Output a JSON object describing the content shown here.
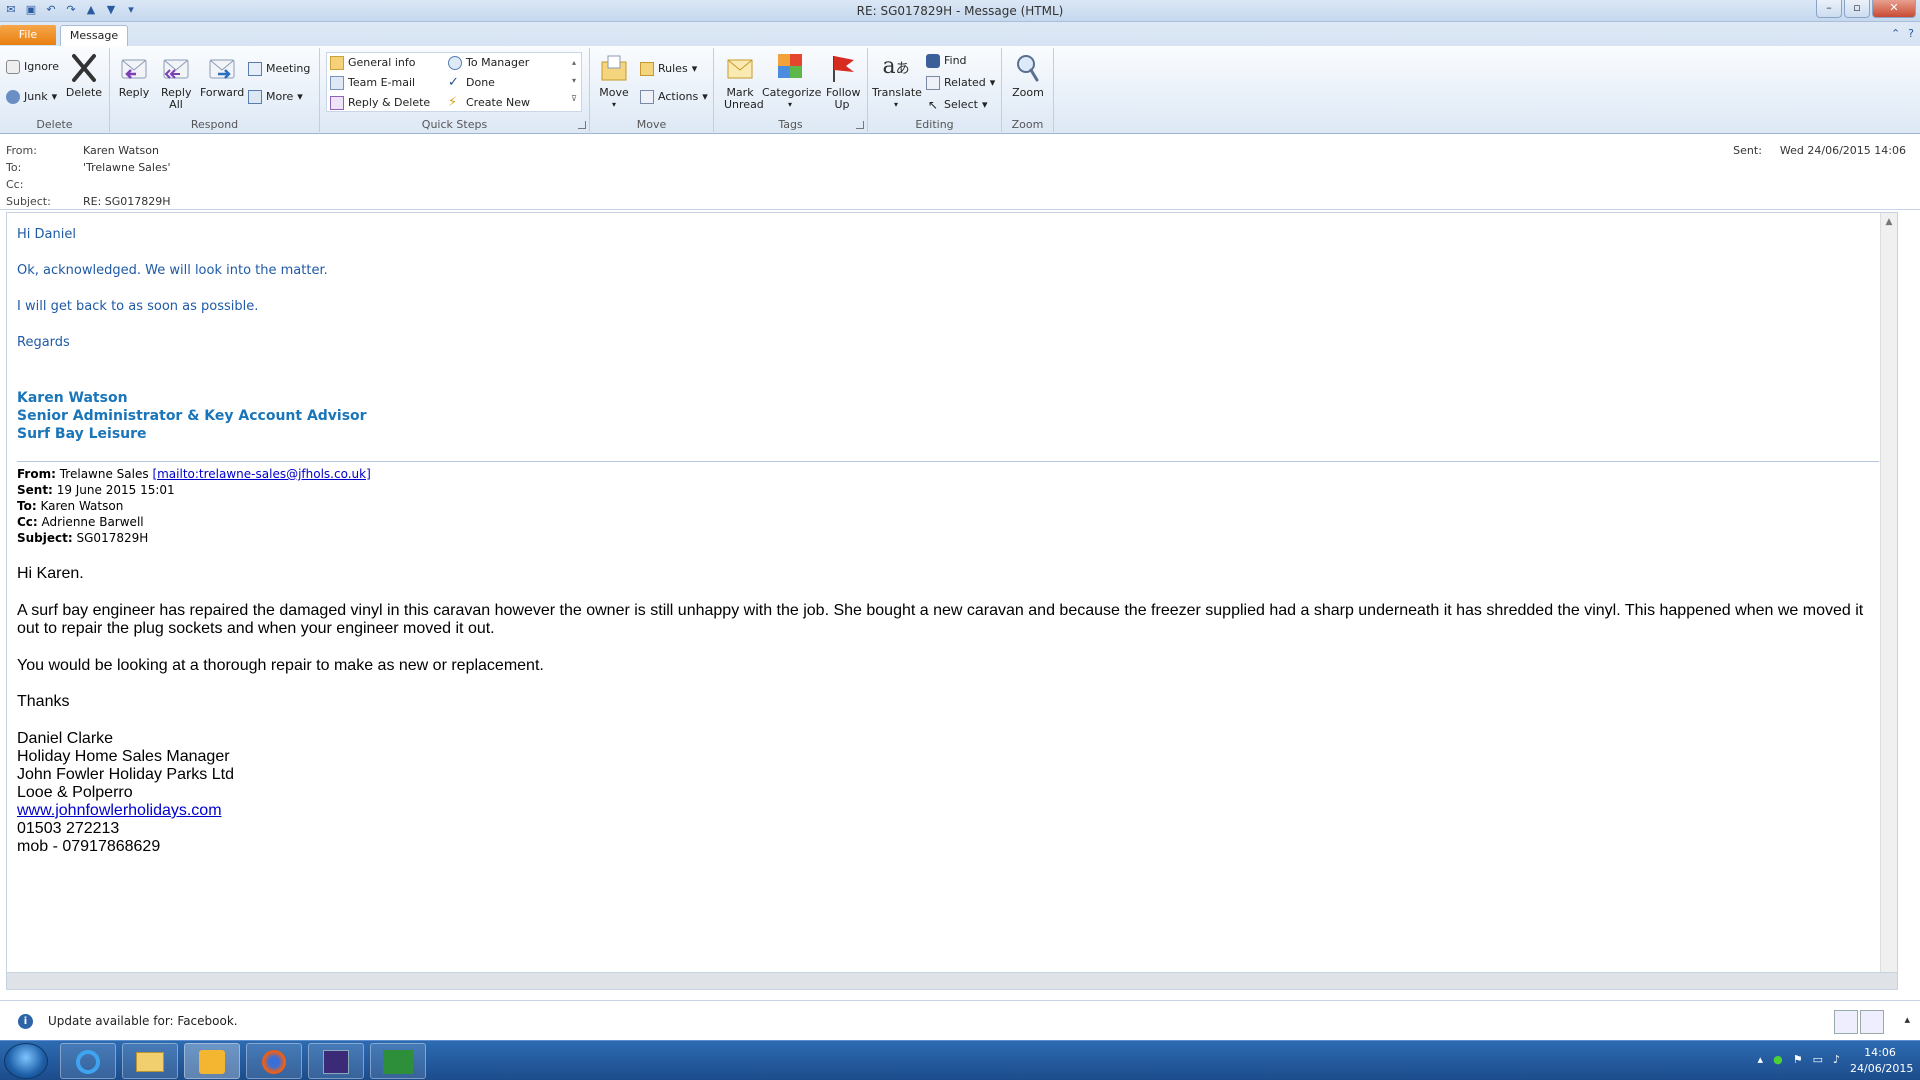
{
  "window": {
    "title": "RE: SG017829H - Message (HTML)"
  },
  "tabs": {
    "file": "File",
    "message": "Message"
  },
  "ribbon": {
    "delete": {
      "label": "Delete",
      "ignore": "Ignore",
      "junk": "Junk",
      "delete": "Delete"
    },
    "respond": {
      "label": "Respond",
      "reply": "Reply",
      "reply_all": "Reply All",
      "forward": "Forward",
      "meeting": "Meeting",
      "more": "More"
    },
    "quick_steps": {
      "label": "Quick Steps",
      "items": [
        "General info",
        "Team E-mail",
        "Reply & Delete",
        "To Manager",
        "Done",
        "Create New"
      ]
    },
    "move": {
      "label": "Move",
      "move": "Move",
      "rules": "Rules",
      "actions": "Actions"
    },
    "tags": {
      "label": "Tags",
      "mark_unread": "Mark Unread",
      "categorize": "Categorize",
      "follow_up": "Follow Up"
    },
    "editing": {
      "label": "Editing",
      "translate": "Translate",
      "find": "Find",
      "related": "Related",
      "select": "Select"
    },
    "zoom": {
      "label": "Zoom",
      "zoom": "Zoom"
    }
  },
  "headers": {
    "from_label": "From:",
    "from": "Karen Watson",
    "to_label": "To:",
    "to": "'Trelawne Sales'",
    "cc_label": "Cc:",
    "cc": "",
    "subject_label": "Subject:",
    "subject": "RE: SG017829H",
    "sent_label": "Sent:",
    "sent": "Wed 24/06/2015 14:06"
  },
  "reply": {
    "greeting": "Hi Daniel",
    "line1": "Ok, acknowledged. We will look into the matter.",
    "line2": "I will get back to as soon as possible.",
    "regards": "Regards",
    "sig_name": "Karen Watson",
    "sig_title": "Senior Administrator & Key Account Advisor",
    "sig_company": "Surf Bay Leisure"
  },
  "original": {
    "from_label": "From:",
    "from_name": "Trelawne Sales",
    "from_link": "[mailto:trelawne-sales@jfhols.co.uk]",
    "sent_label": "Sent:",
    "sent": "19 June 2015 15:01",
    "to_label": "To:",
    "to": "Karen Watson",
    "cc_label": "Cc:",
    "cc": "Adrienne Barwell",
    "subject_label": "Subject:",
    "subject": "SG017829H",
    "greeting": "Hi Karen.",
    "para1": "A surf bay engineer has repaired the damaged vinyl in this caravan however the owner is still unhappy with the job.  She bought a new caravan and because the freezer supplied had a sharp underneath it has shredded the vinyl.  This happened when we moved it out to repair the plug sockets and when your engineer moved it out.",
    "para2": "You would be looking at a thorough repair to make as new or replacement.",
    "thanks": "Thanks",
    "sig_lines": [
      "Daniel Clarke",
      "Holiday Home Sales Manager",
      "John Fowler Holiday Parks Ltd",
      "Looe & Polperro"
    ],
    "website": "www.johnfowlerholidays.com",
    "phone": "01503 272213",
    "mobile": "mob - 07917868629"
  },
  "infobar": {
    "text": "Update available for: Facebook."
  },
  "clock": {
    "time": "14:06",
    "date": "24/06/2015"
  }
}
